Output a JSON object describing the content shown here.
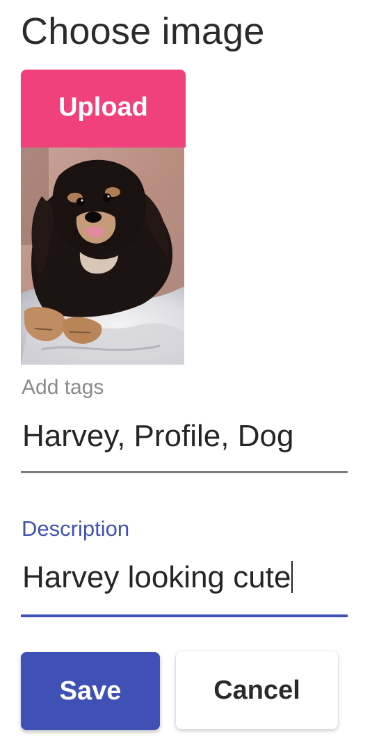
{
  "dialog": {
    "title": "Choose image"
  },
  "upload": {
    "label": "Upload"
  },
  "preview": {
    "icon": "dog-photo"
  },
  "tags": {
    "label": "Add tags",
    "value": "Harvey, Profile, Dog"
  },
  "description": {
    "label": "Description",
    "value": "Harvey looking cute"
  },
  "actions": {
    "save_label": "Save",
    "cancel_label": "Cancel"
  },
  "colors": {
    "upload": "#f0417c",
    "primary": "#3f51b5",
    "tags_underline": "#7f7a7a"
  }
}
